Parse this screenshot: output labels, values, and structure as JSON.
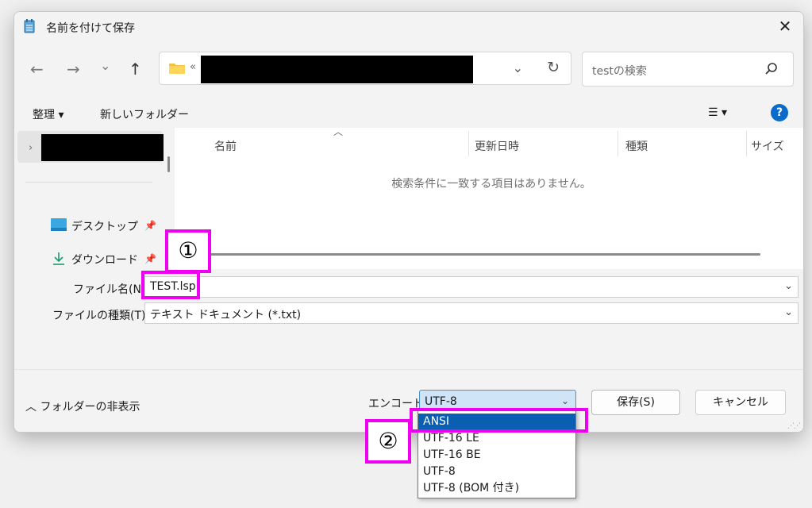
{
  "window": {
    "title": "名前を付けて保存",
    "close": "✕"
  },
  "nav": {
    "back": "←",
    "forward": "→",
    "recent": "⌄",
    "up": "↑",
    "address_prefix": "«"
  },
  "search": {
    "placeholder": "testの検索"
  },
  "toolbar": {
    "organize": "整理 ▾",
    "new_folder": "新しいフォルダー",
    "view": "☰ ▾",
    "help": "?"
  },
  "navpane": {
    "items": [
      {
        "label": "デスクトップ",
        "icon": "desktop-icon"
      },
      {
        "label": "ダウンロード",
        "icon": "download-icon"
      }
    ]
  },
  "filelist": {
    "columns": [
      "名前",
      "更新日時",
      "種類",
      "サイズ"
    ],
    "empty_message": "検索条件に一致する項目はありません。"
  },
  "form": {
    "filename_label": "ファイル名(N):",
    "filename_value": "TEST.lsp",
    "filetype_label": "ファイルの種類(T):",
    "filetype_value": "テキスト ドキュメント (*.txt)"
  },
  "footer": {
    "hide_folders": "フォルダーの非表示",
    "encoding_label": "エンコード:",
    "encoding_value": "UTF-8",
    "save": "保存(S)",
    "cancel": "キャンセル"
  },
  "encoding_options": [
    "ANSI",
    "UTF-16 LE",
    "UTF-16 BE",
    "UTF-8",
    "UTF-8 (BOM 付き)"
  ],
  "encoding_highlighted": "ANSI",
  "annotations": {
    "mark1": "①",
    "mark2": "②"
  },
  "colors": {
    "accent": "#0b5fb3",
    "highlight": "#f000f0",
    "help": "#0b6bcb"
  }
}
